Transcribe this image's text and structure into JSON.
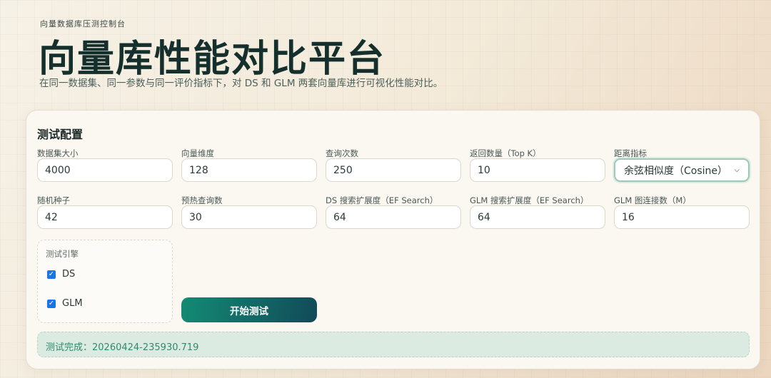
{
  "header": {
    "eyebrow": "向量数据库压测控制台",
    "title": "向量库性能对比平台",
    "subtitle": "在同一数据集、同一参数与同一评价指标下，对 DS 和 GLM 两套向量库进行可视化性能对比。"
  },
  "config": {
    "title": "测试配置",
    "fields": [
      {
        "label": "数据集大小",
        "value": "4000"
      },
      {
        "label": "向量维度",
        "value": "128"
      },
      {
        "label": "查询次数",
        "value": "250"
      },
      {
        "label": "返回数量（Top K）",
        "value": "10"
      },
      {
        "label": "距离指标",
        "value": "余弦相似度（Cosine）"
      },
      {
        "label": "随机种子",
        "value": "42"
      },
      {
        "label": "预热查询数",
        "value": "30"
      },
      {
        "label": "DS 搜索扩展度（EF Search）",
        "value": "64"
      },
      {
        "label": "GLM 搜索扩展度（EF Search）",
        "value": "64"
      },
      {
        "label": "GLM 图连接数（M）",
        "value": "16"
      }
    ],
    "engines": {
      "label": "测试引擎",
      "items": [
        {
          "label": "DS",
          "checked": true
        },
        {
          "label": "GLM",
          "checked": true
        }
      ]
    },
    "start_label": "开始测试",
    "status": "测试完成：20260424-235930.719"
  }
}
